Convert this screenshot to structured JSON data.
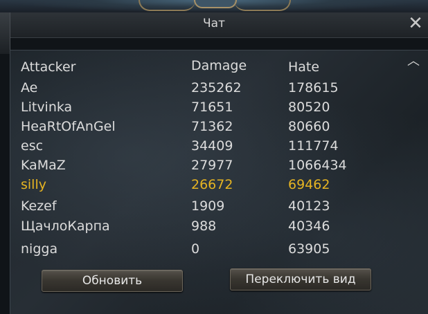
{
  "window": {
    "title": "Чат",
    "close_icon": "close-icon",
    "collapse_icon": "chevron-up-icon"
  },
  "table": {
    "columns": [
      "Attacker",
      "Damage",
      "Hate"
    ],
    "rows": [
      {
        "attacker": "Ae",
        "damage": "235262",
        "hate": "178615",
        "highlight": false
      },
      {
        "attacker": "Litvinka",
        "damage": "71651",
        "hate": "80520",
        "highlight": false
      },
      {
        "attacker": "HeaRtOfAnGel",
        "damage": "71362",
        "hate": "80660",
        "highlight": false
      },
      {
        "attacker": "esc",
        "damage": "34409",
        "hate": "111774",
        "highlight": false
      },
      {
        "attacker": "KaMaZ",
        "damage": "27977",
        "hate": "1066434",
        "highlight": false
      },
      {
        "attacker": "silly",
        "damage": "26672",
        "hate": "69462",
        "highlight": true
      },
      {
        "attacker": "Kezef",
        "damage": "1909",
        "hate": "40123",
        "highlight": false
      },
      {
        "attacker": "ЩачлоКарпа",
        "damage": "988",
        "hate": "40346",
        "highlight": false
      },
      {
        "attacker": "nigga",
        "damage": "0",
        "hate": "63905",
        "highlight": false
      }
    ]
  },
  "buttons": {
    "refresh_label": "Обновить",
    "switch_view_label": "Переключить вид"
  },
  "colors": {
    "text": "#dcdcdc",
    "highlight": "#e6b422"
  }
}
